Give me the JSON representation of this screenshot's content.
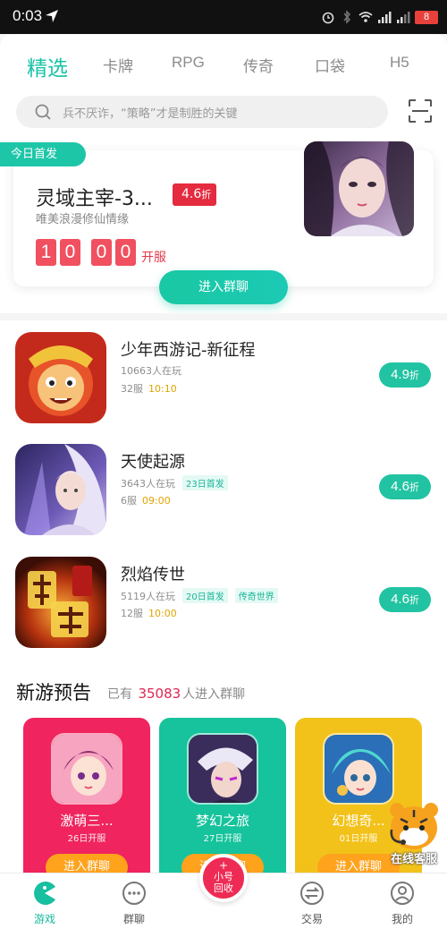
{
  "status_bar": {
    "time": "0:03",
    "battery": "8"
  },
  "tabs": [
    "精选",
    "卡牌",
    "RPG",
    "传奇",
    "口袋",
    "H5"
  ],
  "search": {
    "placeholder": "兵不厌诈，“策略”才是制胜的关键"
  },
  "featured": {
    "badge": "今日首发",
    "title": "灵域主宰-3...",
    "discount_value": "4.6",
    "discount_unit": "折",
    "subtitle": "唯美浪漫修仙情缘",
    "countdown": [
      "1",
      "0",
      "0",
      "0"
    ],
    "countdown_label": "开服",
    "join_label": "进入群聊"
  },
  "games": [
    {
      "name": "少年西游记-新征程",
      "players": "10663人在玩",
      "tags": [],
      "server": "32服",
      "time": "10:10",
      "discount": "4.9",
      "unit": "折"
    },
    {
      "name": "天使起源",
      "players": "3643人在玩",
      "tags": [
        "23日首发"
      ],
      "server": "6服",
      "time": "09:00",
      "discount": "4.6",
      "unit": "折"
    },
    {
      "name": "烈焰传世",
      "players": "5119人在玩",
      "tags": [
        "20日首发",
        "传奇世界"
      ],
      "server": "12服",
      "time": "10:00",
      "discount": "4.6",
      "unit": "折"
    }
  ],
  "preview": {
    "title": "新游预告",
    "sub_prefix": "已有",
    "count": "35083",
    "sub_suffix": "人进入群聊",
    "cards": [
      {
        "name": "激萌三...",
        "date": "26日开服",
        "join": "进入群聊",
        "color": "#f0245e"
      },
      {
        "name": "梦幻之旅",
        "date": "27日开服",
        "join": "进入群聊",
        "color": "#16c39c"
      },
      {
        "name": "幻想奇...",
        "date": "01日开服",
        "join": "进入群聊",
        "color": "#f2c21a"
      }
    ]
  },
  "online_service": "在线客服",
  "bottom_nav": {
    "items": [
      "游戏",
      "群聊",
      "交易",
      "我的"
    ],
    "center_top": "小号",
    "center_bottom": "回收"
  },
  "colors": {
    "accent": "#17c3a6",
    "red": "#e42b3f",
    "orange": "#ffa21c"
  }
}
